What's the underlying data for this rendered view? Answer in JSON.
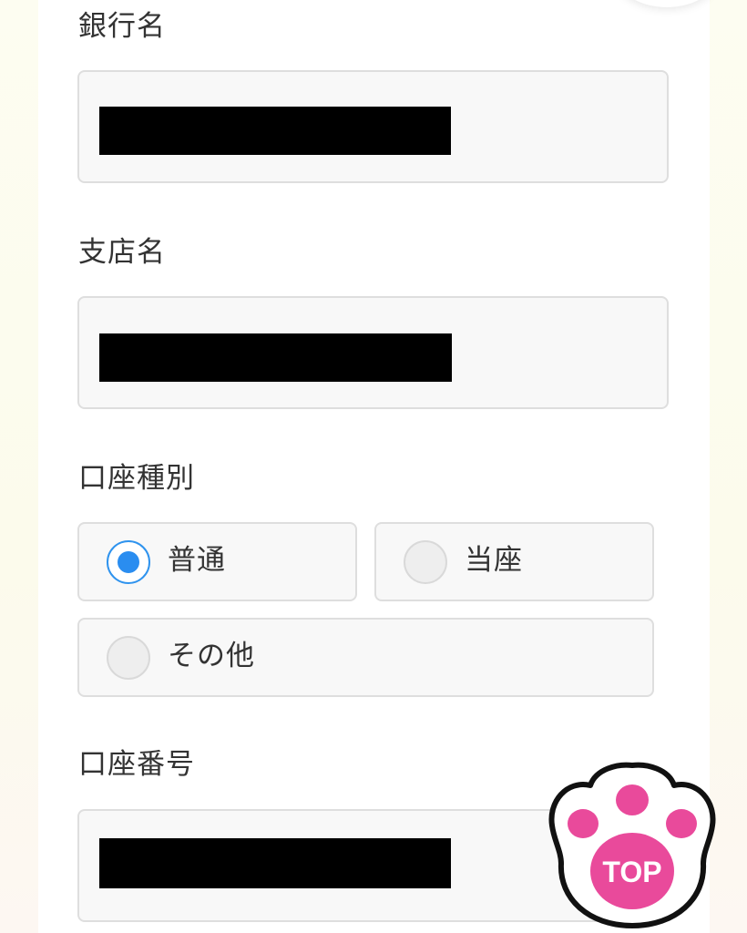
{
  "form": {
    "bank_name": {
      "label": "銀行名",
      "value_redacted": true
    },
    "branch_name": {
      "label": "支店名",
      "value_redacted": true
    },
    "account_type": {
      "label": "口座種別",
      "options": [
        {
          "label": "普通",
          "selected": true
        },
        {
          "label": "当座",
          "selected": false
        },
        {
          "label": "その他",
          "selected": false
        }
      ]
    },
    "account_number": {
      "label": "口座番号",
      "value_redacted": true
    }
  },
  "top_button": {
    "label": "TOP",
    "icon": "paw-icon"
  },
  "colors": {
    "radio_selected": "#2a8df0",
    "paw_pink": "#e94a9b",
    "paw_outline": "#111111"
  }
}
